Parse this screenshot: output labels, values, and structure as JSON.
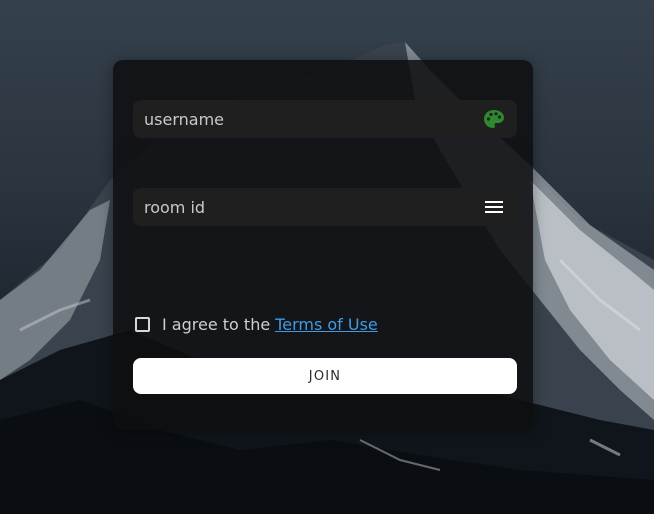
{
  "colors": {
    "card_background": "#0e0e10",
    "field_background": "#1f1f20",
    "link": "#3f9be3",
    "palette_icon": "#2f8a2f",
    "button_background": "#ffffff"
  },
  "form": {
    "username": {
      "placeholder": "username",
      "value": "",
      "icon": "palette-icon"
    },
    "room_id": {
      "placeholder": "room id",
      "value": "",
      "icon": "menu-icon"
    },
    "agree": {
      "checked": false,
      "text": "I agree to the",
      "link_text": "Terms of Use"
    },
    "join_label": "JOIN"
  }
}
